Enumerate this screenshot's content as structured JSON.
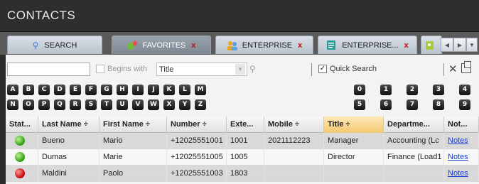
{
  "app": {
    "title": "CONTACTS"
  },
  "tabs": [
    {
      "label": "SEARCH",
      "icon": "search-icon",
      "close": ""
    },
    {
      "label": "FAVORITES",
      "icon": "favorites-star-icon",
      "close": "x"
    },
    {
      "label": "ENTERPRISE",
      "icon": "enterprise-contacts-icon",
      "close": "x"
    },
    {
      "label": "ENTERPRISE...",
      "icon": "enterprise-directory-icon",
      "close": "x"
    }
  ],
  "search": {
    "value": "",
    "begins_with_label": "Begins with",
    "begins_with_checked": false,
    "field_value": "Title",
    "quick_search_label": "Quick Search",
    "quick_search_checked": true,
    "check_glyph": "✓",
    "clear_glyph": "✕"
  },
  "letters_row1": [
    "A",
    "B",
    "C",
    "D",
    "E",
    "F",
    "G",
    "H",
    "I",
    "J",
    "K",
    "L",
    "M"
  ],
  "letters_row2": [
    "N",
    "O",
    "P",
    "Q",
    "R",
    "S",
    "T",
    "U",
    "V",
    "W",
    "X",
    "Y",
    "Z"
  ],
  "digits_row1": [
    "0",
    "1",
    "2",
    "3",
    "4"
  ],
  "digits_row2": [
    "5",
    "6",
    "7",
    "8",
    "9"
  ],
  "table": {
    "columns": [
      "Stat...",
      "Last Name ÷",
      "First Name ÷",
      "Number ÷",
      "Exte...",
      "Mobile ÷",
      "Title ÷",
      "Departme...",
      "Not..."
    ],
    "rows": [
      {
        "status": "green",
        "last": "Bueno",
        "first": "Mario",
        "number": "+12025551001",
        "ext": "1001",
        "mobile": "2021112223",
        "title": "Manager",
        "dept": "Accounting (Lc",
        "notes": "Notes"
      },
      {
        "status": "green",
        "last": "Dumas",
        "first": "Marie",
        "number": "+12025551005",
        "ext": "1005",
        "mobile": "",
        "title": "Director",
        "dept": "Finance (Load1",
        "notes": "Notes"
      },
      {
        "status": "red",
        "last": "Maldini",
        "first": "Paolo",
        "number": "+12025551003",
        "ext": "1803",
        "mobile": "",
        "title": "",
        "dept": "",
        "notes": "Notes"
      }
    ]
  },
  "colors": {
    "status_available": "#2f9a12",
    "status_busy": "#c30000",
    "sorted_header": "#f4c870",
    "link": "#1a3fd0"
  }
}
